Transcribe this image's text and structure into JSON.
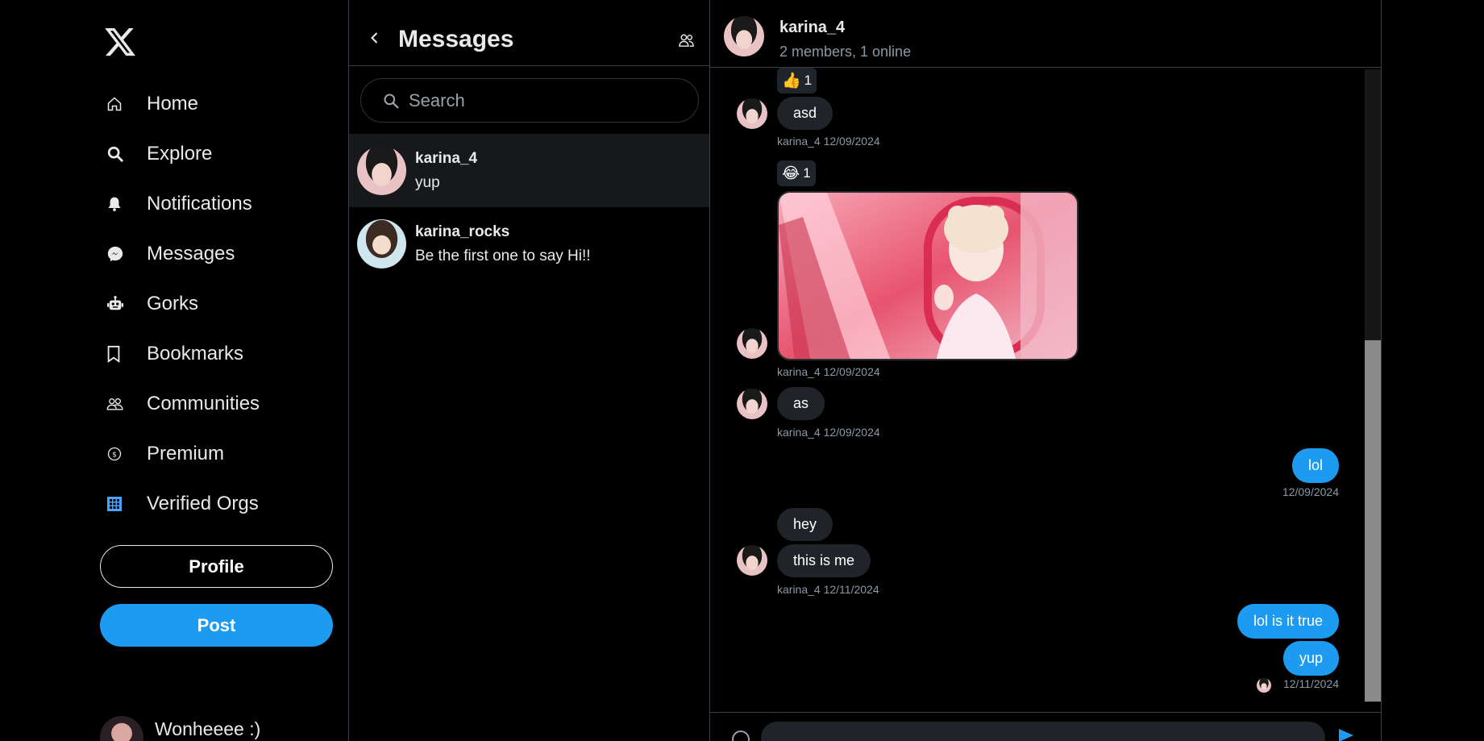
{
  "nav": {
    "logo": "x-logo",
    "items": [
      {
        "label": "Home",
        "icon": "home-icon"
      },
      {
        "label": "Explore",
        "icon": "search-icon"
      },
      {
        "label": "Notifications",
        "icon": "bell-icon"
      },
      {
        "label": "Messages",
        "icon": "messenger-icon"
      },
      {
        "label": "Gorks",
        "icon": "robot-icon"
      },
      {
        "label": "Bookmarks",
        "icon": "bookmark-icon"
      },
      {
        "label": "Communities",
        "icon": "people-icon"
      },
      {
        "label": "Premium",
        "icon": "premium-icon"
      },
      {
        "label": "Verified Orgs",
        "icon": "building-icon"
      }
    ],
    "profile_label": "Profile",
    "post_label": "Post",
    "user_name": "Wonheeee :)"
  },
  "list": {
    "title": "Messages",
    "search_placeholder": "Search",
    "conversations": [
      {
        "name": "karina_4",
        "preview": "yup",
        "active": true
      },
      {
        "name": "karina_rocks",
        "preview": "Be the first one to say Hi!!",
        "active": false
      }
    ]
  },
  "chat": {
    "title": "karina_4",
    "subtitle": "2 members, 1 online",
    "messages": [
      {
        "reaction_emoji": "👍",
        "reaction_count": "1",
        "text": "asd",
        "meta": "karina_4 12/09/2024"
      },
      {
        "reaction_emoji": "😂",
        "reaction_count": "1",
        "image": "photo",
        "meta": "karina_4 12/09/2024"
      },
      {
        "text": "as",
        "meta": "karina_4 12/09/2024"
      },
      {
        "text": "lol",
        "meta": "12/09/2024",
        "outgoing": true
      },
      {
        "text": "hey"
      },
      {
        "text": "this is me",
        "meta": "karina_4 12/11/2024"
      },
      {
        "text": "lol is it true",
        "outgoing": true
      },
      {
        "text": "yup",
        "meta": "12/11/2024",
        "outgoing": true
      }
    ]
  },
  "colors": {
    "accent": "#1d9bf0",
    "background": "#000000",
    "bubble_in": "#202327",
    "divider": "#3a3f4a"
  }
}
